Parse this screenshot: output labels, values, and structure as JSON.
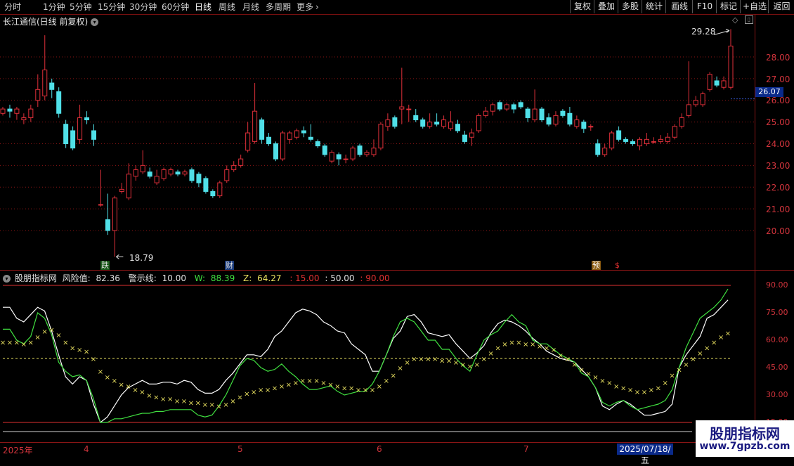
{
  "toolbar": {
    "timeframes": [
      "分时",
      "1分钟",
      "5分钟",
      "15分钟",
      "30分钟",
      "60分钟",
      "日线",
      "周线",
      "月线",
      "多周期",
      "更多"
    ],
    "active_timeframe": "日线",
    "more_chevron": "›",
    "buttons": [
      "复权",
      "叠加",
      "多股",
      "统计",
      "画线",
      "F10",
      "标记",
      "+自选",
      "返回"
    ]
  },
  "main_chart": {
    "title": "长江通信(日线 前复权)",
    "high_label": "29.28",
    "low_label": "18.79",
    "current_price": "26.07",
    "y_ticks": [
      "28.00",
      "27.00",
      "26.00",
      "25.00",
      "24.00",
      "23.00",
      "22.00",
      "21.00",
      "20.00"
    ],
    "markers": {
      "die": "跌",
      "cai": "财",
      "yu": "预",
      "s": "$"
    }
  },
  "indicator": {
    "name": "股朋指标网",
    "risk_label": "风险值:",
    "risk_value": "82.36",
    "warn_label": "警示线:",
    "warn_value": "10.00",
    "w_label": "W:",
    "w_value": "88.39",
    "z_label": "Z:",
    "z_value": "64.27",
    "l1": ": 15.00",
    "l2": ": 50.00",
    "l3": ": 90.00",
    "y_ticks": [
      "90.00",
      "75.00",
      "60.00",
      "45.00",
      "30.00",
      "15.00"
    ]
  },
  "date_axis": {
    "labels": [
      "2025年",
      "4",
      "5",
      "6",
      "7"
    ],
    "highlighted_date": "2025/07/18/五"
  },
  "watermark": {
    "line1": "股朋指标网",
    "line2": "www.7gpzb.com"
  },
  "colors": {
    "up": "#e0303a",
    "down": "#50e0e8",
    "w_line": "#ffffff",
    "z_line": "#40e040",
    "cross": "#e8e060",
    "grid": "#8a1515"
  },
  "chart_data": [
    {
      "type": "candlestick",
      "title": "长江通信(日线 前复权)",
      "y_range": [
        18.4,
        29.6
      ],
      "candles": [
        {
          "o": 25.4,
          "c": 25.6,
          "h": 25.7,
          "l": 25.3
        },
        {
          "o": 25.6,
          "c": 25.5,
          "h": 25.8,
          "l": 25.2
        },
        {
          "o": 25.4,
          "c": 25.6,
          "h": 25.7,
          "l": 25.1
        },
        {
          "o": 25.1,
          "c": 25.2,
          "h": 25.4,
          "l": 24.9
        },
        {
          "o": 25.2,
          "c": 25.6,
          "h": 25.8,
          "l": 25.0
        },
        {
          "o": 26.0,
          "c": 26.5,
          "h": 27.2,
          "l": 25.7
        },
        {
          "o": 26.2,
          "c": 27.4,
          "h": 29.0,
          "l": 26.0
        },
        {
          "o": 26.8,
          "c": 26.5,
          "h": 27.0,
          "l": 26.1
        },
        {
          "o": 26.4,
          "c": 25.4,
          "h": 26.6,
          "l": 25.2
        },
        {
          "o": 24.9,
          "c": 24.0,
          "h": 25.1,
          "l": 23.8
        },
        {
          "o": 24.6,
          "c": 23.8,
          "h": 24.8,
          "l": 23.7
        },
        {
          "o": 24.2,
          "c": 25.2,
          "h": 25.8,
          "l": 24.0
        },
        {
          "o": 25.2,
          "c": 25.1,
          "h": 25.5,
          "l": 24.9
        },
        {
          "o": 24.6,
          "c": 24.2,
          "h": 24.9,
          "l": 23.9
        },
        {
          "o": 21.2,
          "c": 21.2,
          "h": 22.8,
          "l": 21.1
        },
        {
          "o": 20.5,
          "c": 20.0,
          "h": 21.7,
          "l": 19.8
        },
        {
          "o": 20.0,
          "c": 21.5,
          "h": 21.6,
          "l": 18.79
        },
        {
          "o": 21.8,
          "c": 21.9,
          "h": 22.2,
          "l": 21.7
        },
        {
          "o": 21.5,
          "c": 22.6,
          "h": 23.1,
          "l": 21.4
        },
        {
          "o": 22.5,
          "c": 22.8,
          "h": 23.0,
          "l": 22.3
        },
        {
          "o": 22.7,
          "c": 23.0,
          "h": 23.7,
          "l": 22.6
        },
        {
          "o": 22.7,
          "c": 22.5,
          "h": 22.9,
          "l": 22.4
        },
        {
          "o": 22.2,
          "c": 22.5,
          "h": 22.8,
          "l": 22.1
        },
        {
          "o": 22.4,
          "c": 22.8,
          "h": 22.9,
          "l": 22.3
        },
        {
          "o": 22.6,
          "c": 22.8,
          "h": 22.9,
          "l": 22.5
        },
        {
          "o": 22.7,
          "c": 22.6,
          "h": 22.8,
          "l": 22.5
        },
        {
          "o": 22.6,
          "c": 22.7,
          "h": 22.8,
          "l": 22.5
        },
        {
          "o": 22.8,
          "c": 22.3,
          "h": 22.9,
          "l": 22.2
        },
        {
          "o": 22.6,
          "c": 22.2,
          "h": 22.7,
          "l": 22.0
        },
        {
          "o": 22.4,
          "c": 21.8,
          "h": 22.5,
          "l": 21.7
        },
        {
          "o": 21.8,
          "c": 21.6,
          "h": 21.9,
          "l": 21.5
        },
        {
          "o": 21.6,
          "c": 22.2,
          "h": 22.3,
          "l": 21.5
        },
        {
          "o": 22.3,
          "c": 22.8,
          "h": 23.0,
          "l": 22.2
        },
        {
          "o": 22.8,
          "c": 23.0,
          "h": 23.2,
          "l": 22.7
        },
        {
          "o": 23.0,
          "c": 23.3,
          "h": 23.5,
          "l": 22.9
        },
        {
          "o": 23.7,
          "c": 24.5,
          "h": 25.0,
          "l": 23.6
        },
        {
          "o": 24.1,
          "c": 25.5,
          "h": 26.8,
          "l": 24.0
        },
        {
          "o": 25.1,
          "c": 24.2,
          "h": 25.2,
          "l": 24.0
        },
        {
          "o": 24.3,
          "c": 24.0,
          "h": 24.5,
          "l": 23.9
        },
        {
          "o": 24.0,
          "c": 23.3,
          "h": 24.1,
          "l": 23.2
        },
        {
          "o": 23.3,
          "c": 24.5,
          "h": 24.6,
          "l": 23.2
        },
        {
          "o": 24.2,
          "c": 24.5,
          "h": 24.6,
          "l": 24.0
        },
        {
          "o": 24.3,
          "c": 24.6,
          "h": 24.7,
          "l": 24.2
        },
        {
          "o": 24.6,
          "c": 24.5,
          "h": 24.8,
          "l": 24.3
        },
        {
          "o": 24.3,
          "c": 24.2,
          "h": 24.9,
          "l": 24.1
        },
        {
          "o": 24.1,
          "c": 23.9,
          "h": 24.2,
          "l": 23.8
        },
        {
          "o": 23.9,
          "c": 23.5,
          "h": 24.0,
          "l": 23.4
        },
        {
          "o": 23.2,
          "c": 23.6,
          "h": 23.7,
          "l": 23.1
        },
        {
          "o": 23.5,
          "c": 23.3,
          "h": 23.6,
          "l": 23.0
        },
        {
          "o": 23.3,
          "c": 23.3,
          "h": 23.5,
          "l": 23.1
        },
        {
          "o": 23.3,
          "c": 23.8,
          "h": 23.9,
          "l": 23.2
        },
        {
          "o": 23.9,
          "c": 23.5,
          "h": 24.0,
          "l": 23.4
        },
        {
          "o": 23.5,
          "c": 23.6,
          "h": 23.7,
          "l": 23.4
        },
        {
          "o": 23.5,
          "c": 23.8,
          "h": 24.2,
          "l": 23.4
        },
        {
          "o": 23.8,
          "c": 24.9,
          "h": 25.0,
          "l": 23.7
        },
        {
          "o": 24.8,
          "c": 25.1,
          "h": 25.4,
          "l": 24.6
        },
        {
          "o": 25.2,
          "c": 24.8,
          "h": 25.3,
          "l": 24.7
        },
        {
          "o": 25.6,
          "c": 25.7,
          "h": 27.5,
          "l": 24.9
        },
        {
          "o": 25.6,
          "c": 25.6,
          "h": 25.8,
          "l": 25.0
        },
        {
          "o": 25.3,
          "c": 25.1,
          "h": 25.6,
          "l": 25.0
        },
        {
          "o": 25.1,
          "c": 24.8,
          "h": 25.2,
          "l": 24.7
        },
        {
          "o": 24.8,
          "c": 25.0,
          "h": 25.4,
          "l": 24.7
        },
        {
          "o": 25.0,
          "c": 24.9,
          "h": 25.4,
          "l": 24.8
        },
        {
          "o": 24.8,
          "c": 25.1,
          "h": 25.3,
          "l": 24.7
        },
        {
          "o": 24.7,
          "c": 25.0,
          "h": 25.5,
          "l": 24.6
        },
        {
          "o": 24.9,
          "c": 24.6,
          "h": 25.1,
          "l": 24.5
        },
        {
          "o": 24.4,
          "c": 24.1,
          "h": 24.6,
          "l": 24.0
        },
        {
          "o": 24.3,
          "c": 24.5,
          "h": 24.7,
          "l": 23.9
        },
        {
          "o": 24.6,
          "c": 25.3,
          "h": 25.4,
          "l": 24.5
        },
        {
          "o": 25.3,
          "c": 25.5,
          "h": 25.7,
          "l": 25.2
        },
        {
          "o": 25.5,
          "c": 25.8,
          "h": 25.9,
          "l": 25.3
        },
        {
          "o": 25.9,
          "c": 25.6,
          "h": 26.0,
          "l": 25.5
        },
        {
          "o": 25.6,
          "c": 25.8,
          "h": 25.9,
          "l": 25.5
        },
        {
          "o": 25.8,
          "c": 25.6,
          "h": 25.9,
          "l": 25.4
        },
        {
          "o": 25.9,
          "c": 25.7,
          "h": 26.0,
          "l": 25.6
        },
        {
          "o": 25.6,
          "c": 25.2,
          "h": 25.7,
          "l": 25.0
        },
        {
          "o": 25.1,
          "c": 25.6,
          "h": 26.5,
          "l": 25.0
        },
        {
          "o": 25.6,
          "c": 25.1,
          "h": 25.7,
          "l": 25.0
        },
        {
          "o": 25.2,
          "c": 24.9,
          "h": 25.4,
          "l": 24.8
        },
        {
          "o": 24.9,
          "c": 25.3,
          "h": 25.5,
          "l": 24.8
        },
        {
          "o": 25.5,
          "c": 25.3,
          "h": 25.6,
          "l": 25.2
        },
        {
          "o": 25.4,
          "c": 24.9,
          "h": 25.7,
          "l": 24.8
        },
        {
          "o": 24.8,
          "c": 25.1,
          "h": 25.3,
          "l": 24.7
        },
        {
          "o": 25.0,
          "c": 24.7,
          "h": 25.1,
          "l": 24.5
        },
        {
          "o": 24.8,
          "c": 24.8,
          "h": 24.9,
          "l": 24.6
        },
        {
          "o": 24.0,
          "c": 23.5,
          "h": 24.2,
          "l": 23.4
        },
        {
          "o": 23.5,
          "c": 23.8,
          "h": 24.0,
          "l": 23.4
        },
        {
          "o": 23.8,
          "c": 24.5,
          "h": 24.6,
          "l": 23.7
        },
        {
          "o": 24.6,
          "c": 24.2,
          "h": 24.8,
          "l": 24.1
        },
        {
          "o": 24.2,
          "c": 24.1,
          "h": 24.3,
          "l": 24.0
        },
        {
          "o": 24.1,
          "c": 24.0,
          "h": 24.2,
          "l": 23.9
        },
        {
          "o": 23.9,
          "c": 24.2,
          "h": 24.3,
          "l": 23.7
        },
        {
          "o": 24.0,
          "c": 24.2,
          "h": 24.5,
          "l": 23.9
        },
        {
          "o": 24.1,
          "c": 24.1,
          "h": 24.3,
          "l": 24.0
        },
        {
          "o": 24.1,
          "c": 24.2,
          "h": 24.4,
          "l": 24.0
        },
        {
          "o": 24.1,
          "c": 24.3,
          "h": 24.5,
          "l": 24.0
        },
        {
          "o": 24.3,
          "c": 24.8,
          "h": 24.9,
          "l": 24.2
        },
        {
          "o": 24.8,
          "c": 25.2,
          "h": 25.4,
          "l": 24.7
        },
        {
          "o": 25.3,
          "c": 25.8,
          "h": 27.8,
          "l": 25.2
        },
        {
          "o": 25.8,
          "c": 26.0,
          "h": 26.2,
          "l": 25.7
        },
        {
          "o": 25.8,
          "c": 26.3,
          "h": 26.4,
          "l": 25.7
        },
        {
          "o": 26.5,
          "c": 27.2,
          "h": 27.3,
          "l": 26.4
        },
        {
          "o": 26.9,
          "c": 26.7,
          "h": 27.1,
          "l": 26.6
        },
        {
          "o": 26.6,
          "c": 26.9,
          "h": 27.1,
          "l": 26.5
        },
        {
          "o": 26.6,
          "c": 28.5,
          "h": 29.28,
          "l": 26.5
        }
      ]
    },
    {
      "type": "line",
      "title": "股朋指标网",
      "y_range": [
        15,
        90
      ],
      "series": [
        {
          "name": "W",
          "values": [
            78,
            78,
            72,
            70,
            74,
            78,
            76,
            65,
            52,
            40,
            36,
            40,
            38,
            25,
            15,
            18,
            24,
            30,
            34,
            36,
            38,
            36,
            36,
            37,
            37,
            36,
            38,
            37,
            33,
            31,
            31,
            33,
            38,
            42,
            47,
            52,
            52,
            51,
            55,
            62,
            65,
            70,
            75,
            77,
            76,
            74,
            70,
            68,
            65,
            64,
            58,
            55,
            52,
            43,
            43,
            52,
            61,
            65,
            73,
            74,
            70,
            64,
            63,
            62,
            63,
            58,
            54,
            50,
            53,
            57,
            64,
            69,
            71,
            70,
            68,
            65,
            61,
            58,
            54,
            52,
            50,
            49,
            48,
            44,
            40,
            34,
            24,
            22,
            25,
            27,
            25,
            22,
            19,
            19,
            20,
            21,
            25,
            45,
            52,
            57,
            62,
            72,
            74,
            78,
            82
          ]
        },
        {
          "name": "Z",
          "values": [
            66,
            66,
            60,
            58,
            62,
            75,
            72,
            63,
            48,
            43,
            40,
            41,
            38,
            28,
            15,
            15,
            17,
            17,
            18,
            19,
            20,
            20,
            21,
            21,
            22,
            22,
            22,
            22,
            19,
            18,
            19,
            24,
            30,
            38,
            46,
            50,
            49,
            45,
            43,
            44,
            47,
            43,
            40,
            36,
            33,
            33,
            34,
            35,
            32,
            30,
            31,
            32,
            32,
            36,
            43,
            52,
            62,
            70,
            72,
            70,
            65,
            60,
            60,
            55,
            55,
            50,
            46,
            43,
            52,
            60,
            63,
            65,
            70,
            74,
            70,
            68,
            60,
            58,
            58,
            55,
            52,
            50,
            48,
            42,
            40,
            34,
            26,
            24,
            26,
            27,
            24,
            22,
            23,
            24,
            25,
            27,
            33,
            45,
            56,
            64,
            72,
            75,
            78,
            82,
            88
          ]
        },
        {
          "name": "cross",
          "values": [
            59,
            59,
            59,
            58,
            59,
            62,
            65,
            66,
            63,
            59,
            56,
            55,
            54,
            50,
            43,
            40,
            38,
            36,
            35,
            33,
            32,
            30,
            29,
            28,
            28,
            27,
            27,
            26,
            26,
            25,
            25,
            24,
            25,
            27,
            29,
            31,
            32,
            33,
            33,
            34,
            35,
            36,
            37,
            38,
            38,
            38,
            37,
            36,
            35,
            34,
            34,
            33,
            33,
            33,
            35,
            38,
            41,
            45,
            48,
            50,
            50,
            50,
            50,
            49,
            49,
            48,
            47,
            46,
            47,
            50,
            53,
            56,
            58,
            59,
            59,
            58,
            58,
            57,
            56,
            55,
            52,
            50,
            47,
            44,
            42,
            40,
            38,
            37,
            35,
            34,
            33,
            32,
            32,
            33,
            34,
            37,
            41,
            44,
            47,
            50,
            53,
            56,
            59,
            62,
            64
          ]
        }
      ],
      "reference_lines": [
        15,
        50,
        90,
        10
      ]
    }
  ]
}
